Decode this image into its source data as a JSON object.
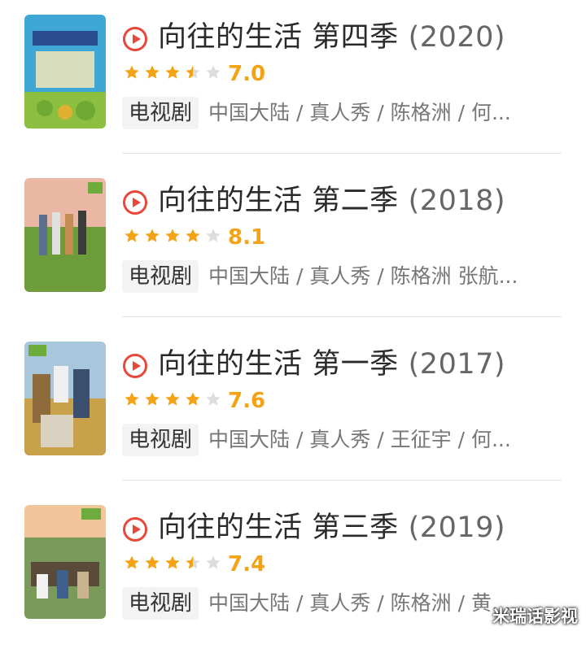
{
  "colors": {
    "accent": "#f4a316",
    "play": "#e8483a",
    "star_empty": "#dddddd"
  },
  "items": [
    {
      "title": "向往的生活 第四季",
      "year": "(2020)",
      "stars": 3.5,
      "rating": "7.0",
      "tag": "电视剧",
      "meta": "中国大陆 / 真人秀 / 陈格洲 / 何...",
      "poster_icon": "poster-season4"
    },
    {
      "title": "向往的生活 第二季",
      "year": "(2018)",
      "stars": 4,
      "rating": "8.1",
      "tag": "电视剧",
      "meta": "中国大陆 / 真人秀 / 陈格洲 张航...",
      "poster_icon": "poster-season2"
    },
    {
      "title": "向往的生活 第一季",
      "year": "(2017)",
      "stars": 4,
      "rating": "7.6",
      "tag": "电视剧",
      "meta": "中国大陆 / 真人秀 / 王征宇 / 何...",
      "poster_icon": "poster-season1"
    },
    {
      "title": "向往的生活 第三季",
      "year": "(2019)",
      "stars": 3.5,
      "rating": "7.4",
      "tag": "电视剧",
      "meta": "中国大陆 / 真人秀 / 陈格洲 / 黄...",
      "poster_icon": "poster-season3"
    }
  ],
  "watermark": "米瑞话影视"
}
